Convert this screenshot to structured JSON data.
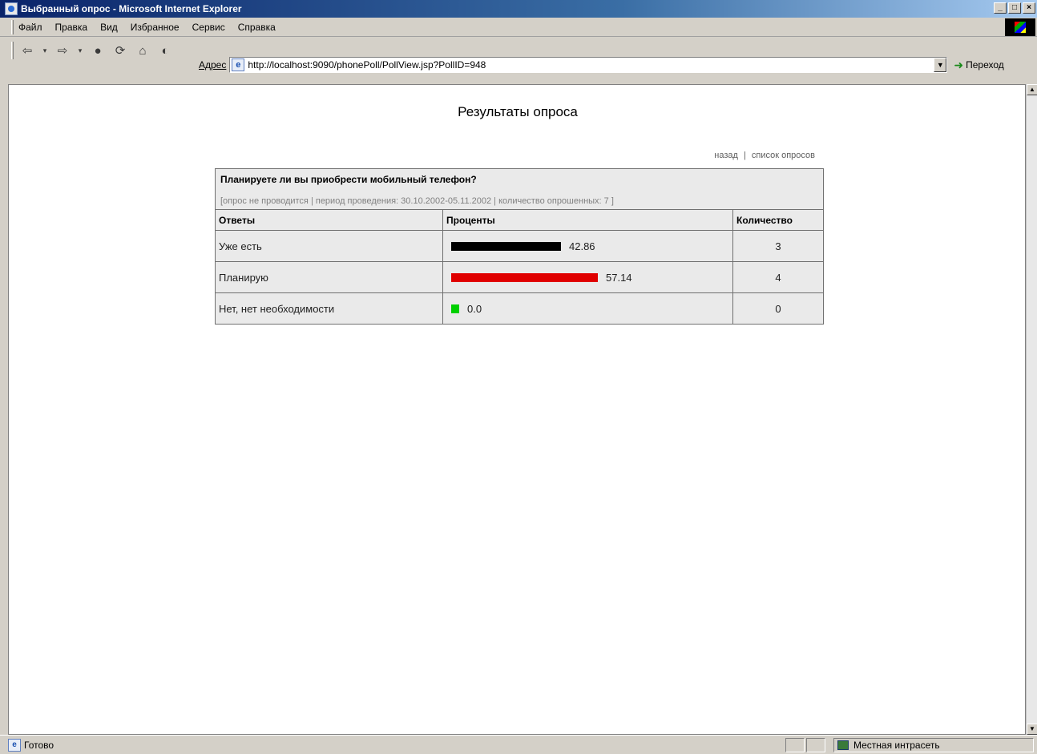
{
  "window": {
    "title": "Выбранный опрос - Microsoft Internet Explorer",
    "buttons": [
      "_",
      "□",
      "×"
    ]
  },
  "menu": [
    "Файл",
    "Правка",
    "Вид",
    "Избранное",
    "Сервис",
    "Справка"
  ],
  "address": {
    "label": "Адрес",
    "url": "http://localhost:9090/phonePoll/PollView.jsp?PollID=948",
    "go_label": "Переход"
  },
  "page": {
    "title": "Результаты опроса",
    "links": {
      "back": "назад",
      "separator": "|",
      "list": "список опросов"
    },
    "poll": {
      "question": "Планируете ли вы приобрести мобильный телефон?",
      "meta": "[опрос не проводится | период проведения: 30.10.2002-05.11.2002 | количество опрошенных: 7 ]",
      "headers": {
        "answers": "Ответы",
        "percent": "Проценты",
        "count": "Количество"
      },
      "rows": [
        {
          "answer": "Уже есть",
          "percent": "42.86",
          "count": "3",
          "bar_color": "#000000",
          "fraction": 0.4286
        },
        {
          "answer": "Планирую",
          "percent": "57.14",
          "count": "4",
          "bar_color": "#e00000",
          "fraction": 0.5714
        },
        {
          "answer": "Нет, нет необходимости",
          "percent": "0.0",
          "count": "0",
          "bar_color": "#00d000",
          "fraction": 0.0
        }
      ]
    }
  },
  "status": {
    "text": "Готово",
    "zone": "Местная интрасеть"
  }
}
